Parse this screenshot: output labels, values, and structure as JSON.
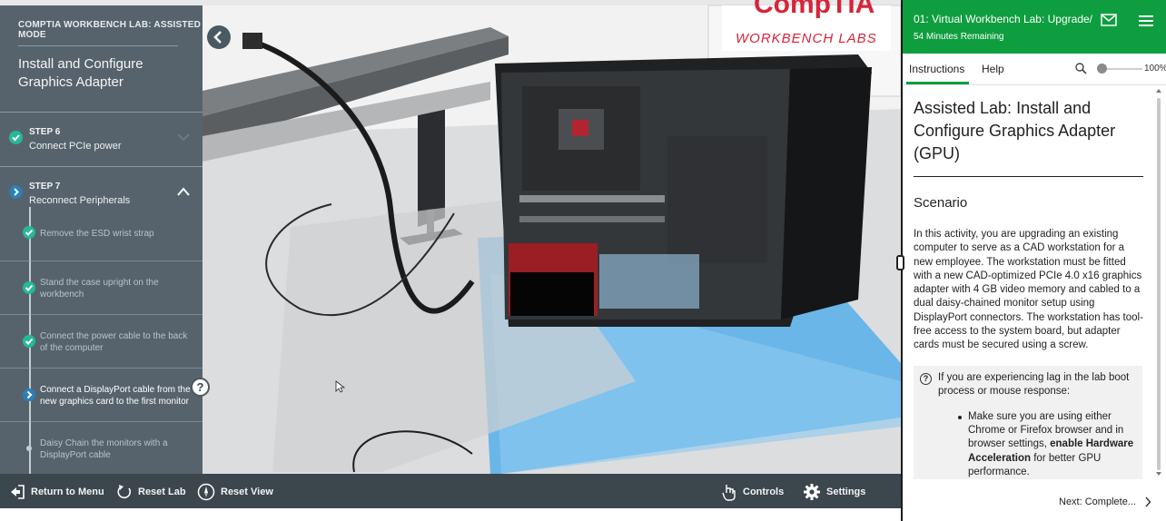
{
  "left_panel": {
    "mode_label": "COMPTIA WORKBENCH LAB: ASSISTED MODE",
    "lab_title": "Install and Configure Graphics Adapter",
    "step6": {
      "number": "STEP 6",
      "name": "Connect PCIe power"
    },
    "step7": {
      "number": "STEP 7",
      "name": "Reconnect Peripherals"
    },
    "substeps": [
      {
        "text": "Remove the ESD wrist strap"
      },
      {
        "text": "Stand the case upright on the workbench"
      },
      {
        "text": "Connect the power cable to the back of the computer"
      },
      {
        "text": "Connect a DisplayPort cable from the new graphics card to the first monitor"
      },
      {
        "text": "Daisy Chain the monitors with a DisplayPort cable"
      }
    ],
    "help_glyph": "?"
  },
  "scene": {
    "brand_top": "CompTIA",
    "brand_sub": "WORKBENCH LABS"
  },
  "toolbar": {
    "return_menu": "Return to Menu",
    "reset_lab": "Reset Lab",
    "reset_view": "Reset View",
    "controls": "Controls",
    "settings": "Settings"
  },
  "pane": {
    "header_title": "01: Virtual Workbench Lab: Upgrade/",
    "time_remaining": "54 Minutes Remaining",
    "tab_instructions": "Instructions",
    "tab_help": "Help",
    "zoom": "100%",
    "zoom_level_fraction": 0.0,
    "doc_title": "Assisted Lab: Install and Configure Graphics Adapter (GPU)",
    "scenario_heading": "Scenario",
    "scenario_text": "In this activity, you are upgrading an existing computer to serve as a CAD workstation for a new employee. The workstation must be fitted with a new CAD-optimized PCIe 4.0 x16 graphics adapter with 4 GB video memory and cabled to a dual daisy-chained monitor setup using DisplayPort connectors. The workstation has tool-free access to the system board, but adapter cards must be secured using a screw.",
    "note_intro": "If you are experiencing lag in the lab boot process or mouse response:",
    "note_item_pre": "Make sure you are using either Chrome or Firefox browser and in browser settings, ",
    "note_item_bold": "enable Hardware Acceleration",
    "note_item_post": " for better GPU performance.",
    "next_label": "Next: Complete..."
  },
  "colors": {
    "accent_green": "#0e9e3f",
    "step_done": "#26b89a",
    "step_current": "#2b7fb8",
    "brand_red": "#d6253a"
  }
}
